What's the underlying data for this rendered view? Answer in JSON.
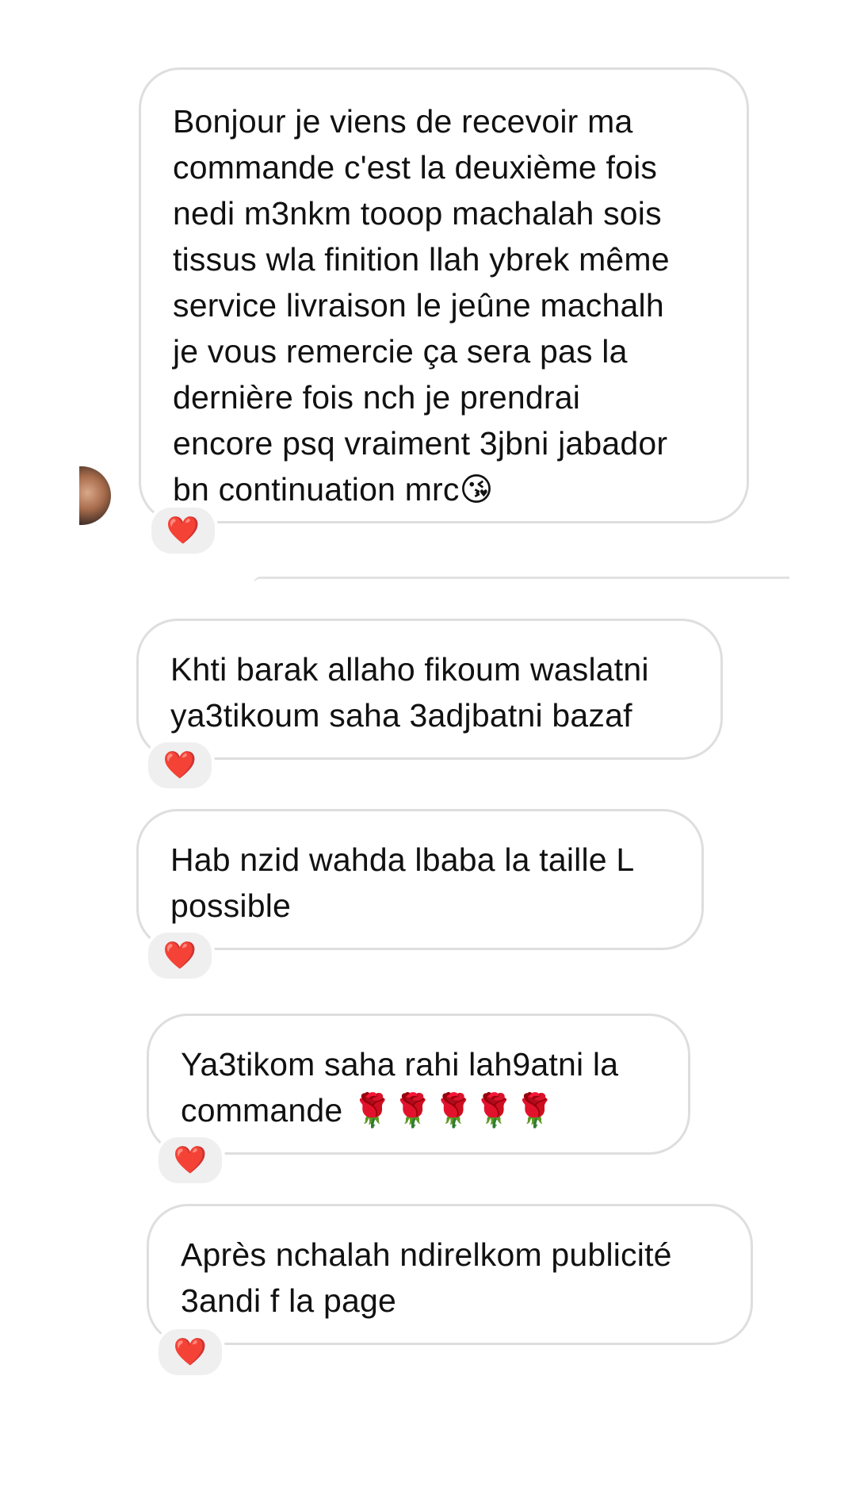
{
  "messages": [
    {
      "text": "Bonjour je viens de recevoir ma\ncommande c'est la deuxième fois\nnedi m3nkm tooop machalah sois\ntissus wla finition llah ybrek même\nservice livraison le jeûne machalh\nje vous remercie ça sera pas la\ndernière fois nch je prendrai\nencore psq vraiment 3jbni jabador\nbn continuation mrc😘",
      "reaction": "❤️"
    },
    {
      "text": "Khti barak allaho fikoum waslatni\nya3tikoum saha 3adjbatni bazaf",
      "reaction": "❤️"
    },
    {
      "text": "Hab nzid wahda lbaba la taille L\npossible",
      "reaction": "❤️"
    },
    {
      "text": "Ya3tikom saha rahi lah9atni la\ncommande 🌹🌹🌹🌹🌹",
      "reaction": "❤️"
    },
    {
      "text": "Après nchalah ndirelkom publicité\n3andi f la page",
      "reaction": "❤️"
    }
  ],
  "colors": {
    "bubble_border": "#dedede",
    "reaction_bg": "#efefef",
    "heart": "#e0173b"
  },
  "icons": {
    "reaction": "heart-icon",
    "sender": "avatar"
  }
}
